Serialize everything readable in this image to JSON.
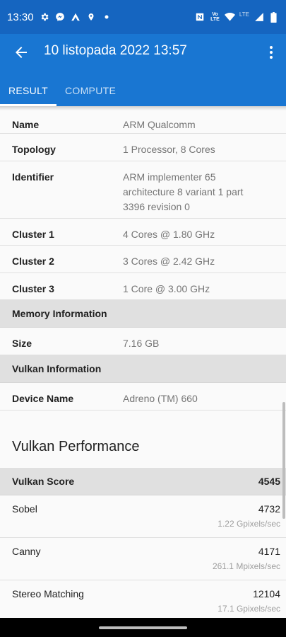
{
  "status_bar": {
    "time": "13:30",
    "lte_label": "LTE",
    "volte_label": "Vo\nLTE",
    "icons_left": [
      "gear-icon",
      "messenger-icon",
      "app-icon",
      "location-icon",
      "dot-icon"
    ],
    "icons_right": [
      "nfc-icon",
      "volte-icon",
      "wifi-icon",
      "signal-icon",
      "battery-icon"
    ]
  },
  "app_bar": {
    "title": "10 listopada 2022 13:57",
    "tabs": [
      {
        "label": "RESULT",
        "active": true
      },
      {
        "label": "COMPUTE",
        "active": false
      }
    ]
  },
  "rows_top": [
    {
      "key": "Name",
      "value": "ARM Qualcomm"
    },
    {
      "key": "Topology",
      "value": "1 Processor, 8 Cores"
    },
    {
      "key": "Identifier",
      "value": "ARM implementer 65 architecture 8 variant 1 part 3396 revision 0"
    },
    {
      "key": "Cluster 1",
      "value": "4 Cores @ 1.80 GHz"
    },
    {
      "key": "Cluster 2",
      "value": "3 Cores @ 2.42 GHz"
    },
    {
      "key": "Cluster 3",
      "value": "1 Core @ 3.00 GHz"
    }
  ],
  "memory_section": {
    "header": "Memory Information",
    "rows": [
      {
        "key": "Size",
        "value": "7.16 GB"
      }
    ]
  },
  "vulkan_section": {
    "header": "Vulkan Information",
    "rows": [
      {
        "key": "Device Name",
        "value": "Adreno (TM) 660"
      }
    ]
  },
  "performance": {
    "title": "Vulkan Performance",
    "score_label": "Vulkan Score",
    "score_value": "4545",
    "benchmarks": [
      {
        "name": "Sobel",
        "score": "4732",
        "unit": "1.22 Gpixels/sec"
      },
      {
        "name": "Canny",
        "score": "4171",
        "unit": "261.1 Mpixels/sec"
      },
      {
        "name": "Stereo Matching",
        "score": "12104",
        "unit": "17.1 Gpixels/sec"
      }
    ]
  },
  "colors": {
    "status_bar": "#1565c0",
    "app_bar": "#1976d2",
    "section_header": "#e0e0e0"
  }
}
